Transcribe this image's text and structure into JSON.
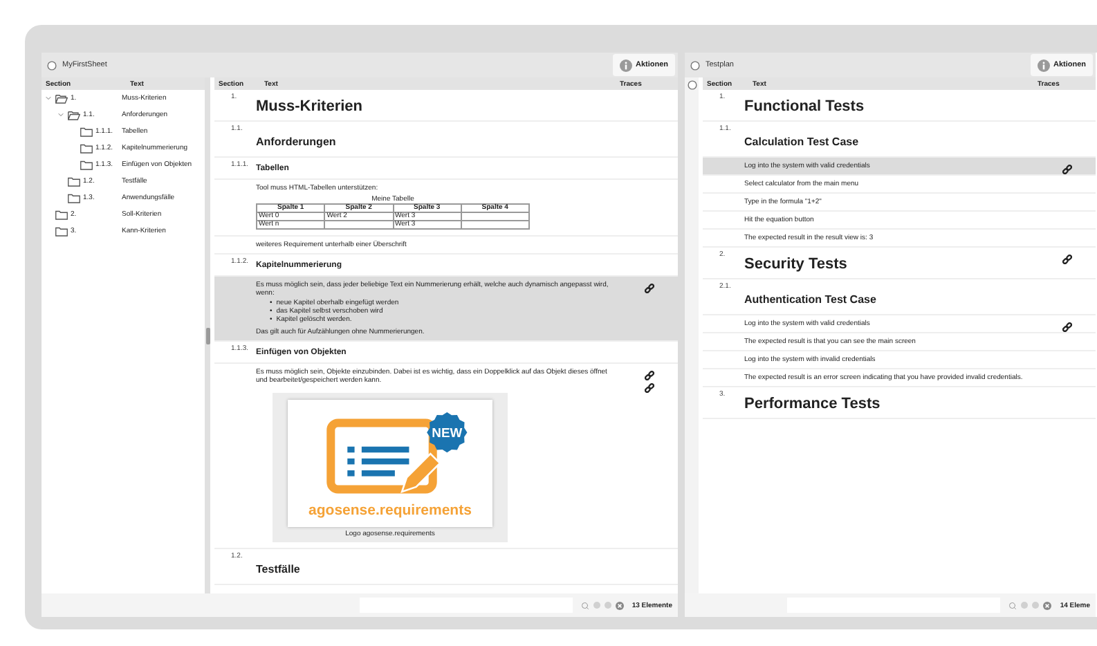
{
  "left": {
    "title": "MyFirstSheet",
    "actions": "Aktionen",
    "tree_columns": [
      "Section",
      "Text"
    ],
    "tree": [
      {
        "section": "1.",
        "text": "Muss-Kriterien",
        "expanded": true,
        "children": [
          {
            "section": "1.1.",
            "text": "Anforderungen",
            "expanded": true,
            "children": [
              {
                "section": "1.1.1.",
                "text": "Tabellen",
                "expanded": false
              },
              {
                "section": "1.1.2.",
                "text": "Kapitelnummerierung",
                "expanded": false
              },
              {
                "section": "1.1.3.",
                "text": "Einfügen von Objekten",
                "expanded": false
              }
            ]
          },
          {
            "section": "1.2.",
            "text": "Testfälle",
            "expanded": false
          },
          {
            "section": "1.3.",
            "text": "Anwendungsfälle",
            "expanded": false
          }
        ]
      },
      {
        "section": "2.",
        "text": "Soll-Kriterien",
        "expanded": false
      },
      {
        "section": "3.",
        "text": "Kann-Kriterien",
        "expanded": false
      }
    ],
    "columns": [
      "Section",
      "Text",
      "Traces"
    ],
    "rows": [
      {
        "kind": "h1",
        "section": "1.",
        "text": "Muss-Kriterien",
        "selected": false
      },
      {
        "kind": "h2",
        "section": "1.1.",
        "text": "Anforderungen",
        "selected": false
      },
      {
        "kind": "h3",
        "section": "1.1.1.",
        "text": "Tabellen",
        "selected": false
      },
      {
        "kind": "table",
        "text": "Tool muss HTML-Tabellen unterstützen:",
        "caption": "Meine Tabelle",
        "header": [
          "Spalte 1",
          "Spalte 2",
          "Spalte 3",
          "Spalte 4"
        ],
        "cells": [
          [
            "Wert 0",
            "Wert 2",
            "Wert 3",
            null
          ],
          [
            "Wert n",
            null,
            "Wert 3",
            null
          ]
        ],
        "selected": false
      },
      {
        "kind": "text",
        "text": "weiteres Requirement unterhalb einer Überschrift",
        "selected": false
      },
      {
        "kind": "h3",
        "section": "1.1.2.",
        "text": "Kapitelnummerierung",
        "selected": false
      },
      {
        "kind": "list",
        "text": "Es muss möglich sein, dass jeder beliebige Text ein Nummerierung erhält, welche auch dynamisch angepasst wird, wenn:",
        "bullet": "•",
        "items": [
          "neue Kapitel oberhalb eingefügt werden",
          "das Kapitel selbst verschoben wird",
          "Kapitel gelöscht werden."
        ],
        "outro": "Das gilt auch für Aufzählungen ohne Nummerierungen.",
        "selected": true,
        "traces": [
          {
            "kind": "link"
          }
        ]
      },
      {
        "kind": "h3",
        "section": "1.1.3.",
        "text": "Einfügen von Objekten",
        "selected": false
      },
      {
        "kind": "image",
        "text": "Es muss möglich sein, Objekte einzubinden. Dabei ist es wichtig, dass ein Doppelklick auf das Objekt dieses öffnet und bearbeitet/gespeichert werden kann.",
        "badge": "NEW",
        "wordmark": "agosense.requirements",
        "caption": "Logo agosense.requirements",
        "selected": false,
        "traces": [
          {
            "kind": "link"
          },
          {
            "kind": "link"
          }
        ]
      },
      {
        "kind": "h2",
        "section": "1.2.",
        "text": "Testfälle",
        "selected": false
      }
    ],
    "count": "13 Elemente"
  },
  "right": {
    "title": "Testplan",
    "actions": "Aktionen",
    "columns": [
      "Section",
      "Text",
      "Traces"
    ],
    "rows": [
      {
        "kind": "h1",
        "section": "1.",
        "text": "Functional Tests",
        "selected": false
      },
      {
        "kind": "h2",
        "section": "1.1.",
        "text": "Calculation Test Case",
        "selected": false
      },
      {
        "kind": "text",
        "text": "Log into the system with valid credentials",
        "selected": true,
        "traces": [
          {
            "kind": "link"
          }
        ]
      },
      {
        "kind": "text",
        "text": "Select calculator from the main menu",
        "selected": false
      },
      {
        "kind": "text",
        "text": "Type in the formula \"1+2\"",
        "selected": false
      },
      {
        "kind": "text",
        "text": "Hit the equation button",
        "selected": false
      },
      {
        "kind": "text",
        "text": "The expected result in the result view is: 3",
        "selected": false
      },
      {
        "kind": "h1",
        "section": "2.",
        "text": "Security Tests",
        "selected": false,
        "traces": [
          {
            "kind": "link"
          }
        ]
      },
      {
        "kind": "h2",
        "section": "2.1.",
        "text": "Authentication Test Case",
        "selected": false
      },
      {
        "kind": "text",
        "text": "Log into the system with valid credentials",
        "selected": false,
        "traces": [
          {
            "kind": "link"
          }
        ]
      },
      {
        "kind": "text",
        "text": "The expected result is that you can see the main screen",
        "selected": false
      },
      {
        "kind": "text",
        "text": "Log into the system with invalid credentials",
        "selected": false
      },
      {
        "kind": "text",
        "text": "The expected result is an error screen indicating that you have provided invalid credentials.",
        "selected": false
      },
      {
        "kind": "h1",
        "section": "3.",
        "text": "Performance Tests",
        "selected": false
      }
    ],
    "count": "14 Eleme"
  }
}
